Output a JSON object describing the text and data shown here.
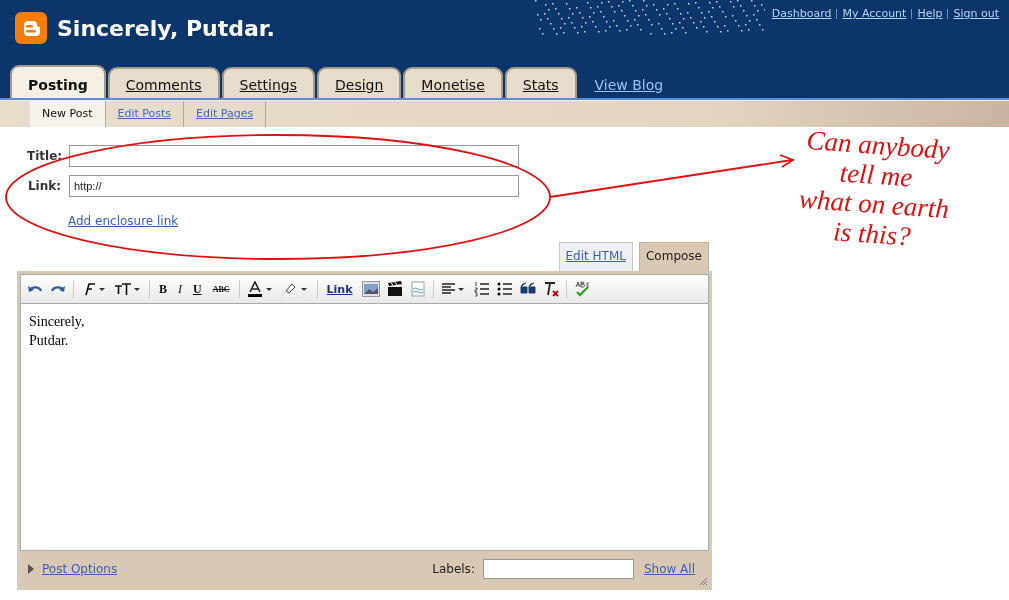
{
  "header": {
    "title": "Sincerely, Putdar.",
    "links": [
      "Dashboard",
      "My Account",
      "Help",
      "Sign out"
    ]
  },
  "tabs": [
    {
      "label": "Posting",
      "selected": true
    },
    {
      "label": "Comments",
      "selected": false
    },
    {
      "label": "Settings",
      "selected": false
    },
    {
      "label": "Design",
      "selected": false
    },
    {
      "label": "Monetise",
      "selected": false
    },
    {
      "label": "Stats",
      "selected": false
    }
  ],
  "view_blog": "View Blog",
  "subtabs": [
    {
      "label": "New Post",
      "selected": true
    },
    {
      "label": "Edit Posts",
      "selected": false
    },
    {
      "label": "Edit Pages",
      "selected": false
    }
  ],
  "form": {
    "title_label": "Title:",
    "link_label": "Link:",
    "link_value": "http://",
    "enclosure_link": "Add enclosure link"
  },
  "mode_tabs": [
    {
      "label": "Edit HTML",
      "selected": false
    },
    {
      "label": "Compose",
      "selected": true
    }
  ],
  "toolbar": [
    {
      "kind": "undo"
    },
    {
      "kind": "redo"
    },
    {
      "kind": "sep"
    },
    {
      "kind": "font"
    },
    {
      "kind": "size"
    },
    {
      "kind": "sep"
    },
    {
      "kind": "bold",
      "label": "B"
    },
    {
      "kind": "italic",
      "label": "I"
    },
    {
      "kind": "underline",
      "label": "U"
    },
    {
      "kind": "strike",
      "label": "ABC"
    },
    {
      "kind": "sep"
    },
    {
      "kind": "color"
    },
    {
      "kind": "highlight"
    },
    {
      "kind": "sep"
    },
    {
      "kind": "link",
      "label": "Link"
    },
    {
      "kind": "image"
    },
    {
      "kind": "video"
    },
    {
      "kind": "pagebreak"
    },
    {
      "kind": "sep"
    },
    {
      "kind": "align"
    },
    {
      "kind": "ol"
    },
    {
      "kind": "ul"
    },
    {
      "kind": "quote"
    },
    {
      "kind": "clear"
    },
    {
      "kind": "sep"
    },
    {
      "kind": "spell"
    }
  ],
  "body": [
    "Sincerely,",
    "Putdar."
  ],
  "footer": {
    "post_options": "Post Options",
    "labels_label": "Labels:",
    "show_all": "Show All"
  },
  "annotation": {
    "lines": [
      "Can anybody",
      "tell me",
      "what on earth",
      "is this?"
    ]
  }
}
